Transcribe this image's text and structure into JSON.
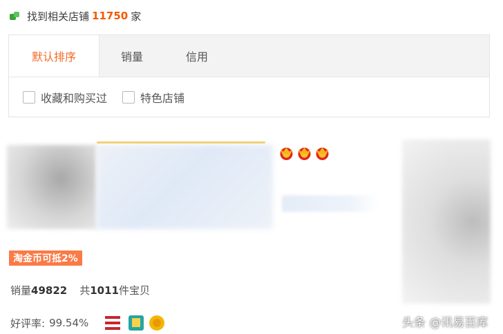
{
  "result": {
    "prefix": "找到相关店铺",
    "count": "11750",
    "suffix": "家"
  },
  "sort_tabs": [
    {
      "label": "默认排序",
      "active": true
    },
    {
      "label": "销量",
      "active": false
    },
    {
      "label": "信用",
      "active": false
    }
  ],
  "filters": [
    {
      "label": "收藏和购买过",
      "checked": false
    },
    {
      "label": "特色店铺",
      "checked": false
    }
  ],
  "shop": {
    "coin_badge": "淘金币可抵2%",
    "sales_label": "销量",
    "sales_value": "49822",
    "items_prefix": "共",
    "items_count": "1011",
    "items_suffix": "件宝贝",
    "rating_label": "好评率:",
    "rating_value": "99.54%",
    "crown_count": 3,
    "badge_icons": [
      "flag-icon",
      "gift-icon",
      "medal-icon"
    ]
  },
  "colors": {
    "accent": "#f26a26",
    "count": "#f25a00",
    "badge_bg": "#fb7a45"
  },
  "watermark": "头条 @讯易百库"
}
